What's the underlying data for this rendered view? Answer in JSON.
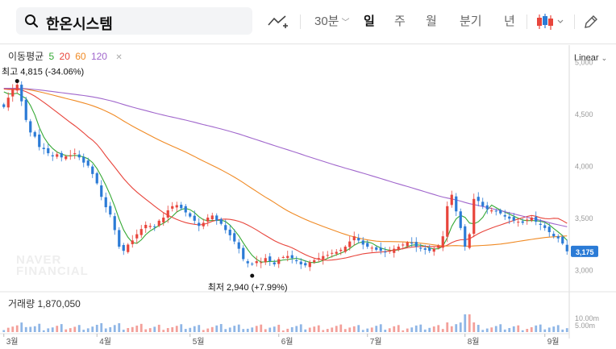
{
  "toolbar": {
    "stock_name": "한온시스템",
    "period_label": "30분",
    "tabs": [
      "일",
      "주",
      "월",
      "분기",
      "년"
    ],
    "active_tab": "일",
    "icons": [
      "search-icon",
      "compare-chart-icon",
      "candle-type-icon",
      "draw-pen-icon"
    ]
  },
  "legend": {
    "ma_label": "이동평균",
    "ma_periods": [
      {
        "period": "5",
        "color": "#35a935"
      },
      {
        "period": "20",
        "color": "#e8453c"
      },
      {
        "period": "60",
        "color": "#f08a24"
      },
      {
        "period": "120",
        "color": "#a066cc"
      }
    ],
    "close_icon": "close-icon"
  },
  "scale_label": "Linear",
  "volume_label": "거래량 1,870,050",
  "watermark": [
    "NAVER",
    "FINANCIAL"
  ],
  "colors": {
    "up": "#e8453c",
    "down": "#2b7bd6",
    "price_tag": "#2b7bd6"
  },
  "chart_data": {
    "type": "candlestick",
    "y_ticks": [
      "5,000",
      "4,500",
      "4,000",
      "3,500",
      "3,000"
    ],
    "y_values": [
      5000,
      4500,
      4000,
      3500,
      3000
    ],
    "ylim": [
      2840,
      5130
    ],
    "x_ticks": [
      "3월",
      "4월",
      "5월",
      "6월",
      "7월",
      "8월",
      "9월"
    ],
    "last_price": "3,175",
    "high_annotation": "최고 4,815 (-34.06%)",
    "low_annotation": "최저 2,940 (+7.99%)",
    "volume_ticks": [
      "10.00m",
      "5.00m"
    ],
    "volume_values": [
      10000000,
      5000000
    ],
    "closes": [
      4565,
      4655,
      4740,
      4780,
      4620,
      4440,
      4320,
      4280,
      4180,
      4160,
      4120,
      4090,
      4110,
      4080,
      4090,
      4100,
      4120,
      4080,
      4030,
      4000,
      3920,
      3830,
      3700,
      3600,
      3530,
      3380,
      3220,
      3180,
      3240,
      3280,
      3340,
      3390,
      3430,
      3420,
      3410,
      3470,
      3500,
      3570,
      3610,
      3620,
      3590,
      3550,
      3510,
      3470,
      3420,
      3450,
      3500,
      3520,
      3470,
      3440,
      3380,
      3330,
      3270,
      3200,
      3100,
      3060,
      3050,
      3080,
      3070,
      3110,
      3080,
      3050,
      3100,
      3120,
      3130,
      3110,
      3080,
      3050,
      3040,
      3070,
      3090,
      3110,
      3130,
      3140,
      3160,
      3170,
      3190,
      3220,
      3270,
      3320,
      3280,
      3240,
      3220,
      3210,
      3190,
      3180,
      3170,
      3180,
      3200,
      3220,
      3240,
      3260,
      3250,
      3220,
      3200,
      3190,
      3180,
      3200,
      3230,
      3320,
      3610,
      3720,
      3560,
      3400,
      3220,
      3340,
      3680,
      3660,
      3610,
      3580,
      3570,
      3560,
      3540,
      3510,
      3490,
      3470,
      3460,
      3450,
      3480,
      3500,
      3460,
      3430,
      3400,
      3360,
      3320,
      3300,
      3250,
      3175
    ]
  }
}
